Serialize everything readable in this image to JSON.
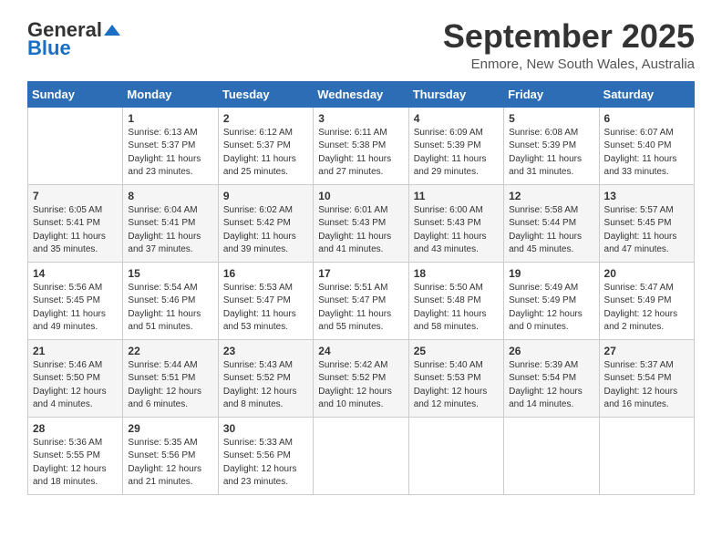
{
  "logo": {
    "general": "General",
    "blue": "Blue"
  },
  "title": "September 2025",
  "subtitle": "Enmore, New South Wales, Australia",
  "days_of_week": [
    "Sunday",
    "Monday",
    "Tuesday",
    "Wednesday",
    "Thursday",
    "Friday",
    "Saturday"
  ],
  "weeks": [
    [
      {
        "day": "",
        "info": ""
      },
      {
        "day": "1",
        "info": "Sunrise: 6:13 AM\nSunset: 5:37 PM\nDaylight: 11 hours\nand 23 minutes."
      },
      {
        "day": "2",
        "info": "Sunrise: 6:12 AM\nSunset: 5:37 PM\nDaylight: 11 hours\nand 25 minutes."
      },
      {
        "day": "3",
        "info": "Sunrise: 6:11 AM\nSunset: 5:38 PM\nDaylight: 11 hours\nand 27 minutes."
      },
      {
        "day": "4",
        "info": "Sunrise: 6:09 AM\nSunset: 5:39 PM\nDaylight: 11 hours\nand 29 minutes."
      },
      {
        "day": "5",
        "info": "Sunrise: 6:08 AM\nSunset: 5:39 PM\nDaylight: 11 hours\nand 31 minutes."
      },
      {
        "day": "6",
        "info": "Sunrise: 6:07 AM\nSunset: 5:40 PM\nDaylight: 11 hours\nand 33 minutes."
      }
    ],
    [
      {
        "day": "7",
        "info": "Sunrise: 6:05 AM\nSunset: 5:41 PM\nDaylight: 11 hours\nand 35 minutes."
      },
      {
        "day": "8",
        "info": "Sunrise: 6:04 AM\nSunset: 5:41 PM\nDaylight: 11 hours\nand 37 minutes."
      },
      {
        "day": "9",
        "info": "Sunrise: 6:02 AM\nSunset: 5:42 PM\nDaylight: 11 hours\nand 39 minutes."
      },
      {
        "day": "10",
        "info": "Sunrise: 6:01 AM\nSunset: 5:43 PM\nDaylight: 11 hours\nand 41 minutes."
      },
      {
        "day": "11",
        "info": "Sunrise: 6:00 AM\nSunset: 5:43 PM\nDaylight: 11 hours\nand 43 minutes."
      },
      {
        "day": "12",
        "info": "Sunrise: 5:58 AM\nSunset: 5:44 PM\nDaylight: 11 hours\nand 45 minutes."
      },
      {
        "day": "13",
        "info": "Sunrise: 5:57 AM\nSunset: 5:45 PM\nDaylight: 11 hours\nand 47 minutes."
      }
    ],
    [
      {
        "day": "14",
        "info": "Sunrise: 5:56 AM\nSunset: 5:45 PM\nDaylight: 11 hours\nand 49 minutes."
      },
      {
        "day": "15",
        "info": "Sunrise: 5:54 AM\nSunset: 5:46 PM\nDaylight: 11 hours\nand 51 minutes."
      },
      {
        "day": "16",
        "info": "Sunrise: 5:53 AM\nSunset: 5:47 PM\nDaylight: 11 hours\nand 53 minutes."
      },
      {
        "day": "17",
        "info": "Sunrise: 5:51 AM\nSunset: 5:47 PM\nDaylight: 11 hours\nand 55 minutes."
      },
      {
        "day": "18",
        "info": "Sunrise: 5:50 AM\nSunset: 5:48 PM\nDaylight: 11 hours\nand 58 minutes."
      },
      {
        "day": "19",
        "info": "Sunrise: 5:49 AM\nSunset: 5:49 PM\nDaylight: 12 hours\nand 0 minutes."
      },
      {
        "day": "20",
        "info": "Sunrise: 5:47 AM\nSunset: 5:49 PM\nDaylight: 12 hours\nand 2 minutes."
      }
    ],
    [
      {
        "day": "21",
        "info": "Sunrise: 5:46 AM\nSunset: 5:50 PM\nDaylight: 12 hours\nand 4 minutes."
      },
      {
        "day": "22",
        "info": "Sunrise: 5:44 AM\nSunset: 5:51 PM\nDaylight: 12 hours\nand 6 minutes."
      },
      {
        "day": "23",
        "info": "Sunrise: 5:43 AM\nSunset: 5:52 PM\nDaylight: 12 hours\nand 8 minutes."
      },
      {
        "day": "24",
        "info": "Sunrise: 5:42 AM\nSunset: 5:52 PM\nDaylight: 12 hours\nand 10 minutes."
      },
      {
        "day": "25",
        "info": "Sunrise: 5:40 AM\nSunset: 5:53 PM\nDaylight: 12 hours\nand 12 minutes."
      },
      {
        "day": "26",
        "info": "Sunrise: 5:39 AM\nSunset: 5:54 PM\nDaylight: 12 hours\nand 14 minutes."
      },
      {
        "day": "27",
        "info": "Sunrise: 5:37 AM\nSunset: 5:54 PM\nDaylight: 12 hours\nand 16 minutes."
      }
    ],
    [
      {
        "day": "28",
        "info": "Sunrise: 5:36 AM\nSunset: 5:55 PM\nDaylight: 12 hours\nand 18 minutes."
      },
      {
        "day": "29",
        "info": "Sunrise: 5:35 AM\nSunset: 5:56 PM\nDaylight: 12 hours\nand 21 minutes."
      },
      {
        "day": "30",
        "info": "Sunrise: 5:33 AM\nSunset: 5:56 PM\nDaylight: 12 hours\nand 23 minutes."
      },
      {
        "day": "",
        "info": ""
      },
      {
        "day": "",
        "info": ""
      },
      {
        "day": "",
        "info": ""
      },
      {
        "day": "",
        "info": ""
      }
    ]
  ]
}
